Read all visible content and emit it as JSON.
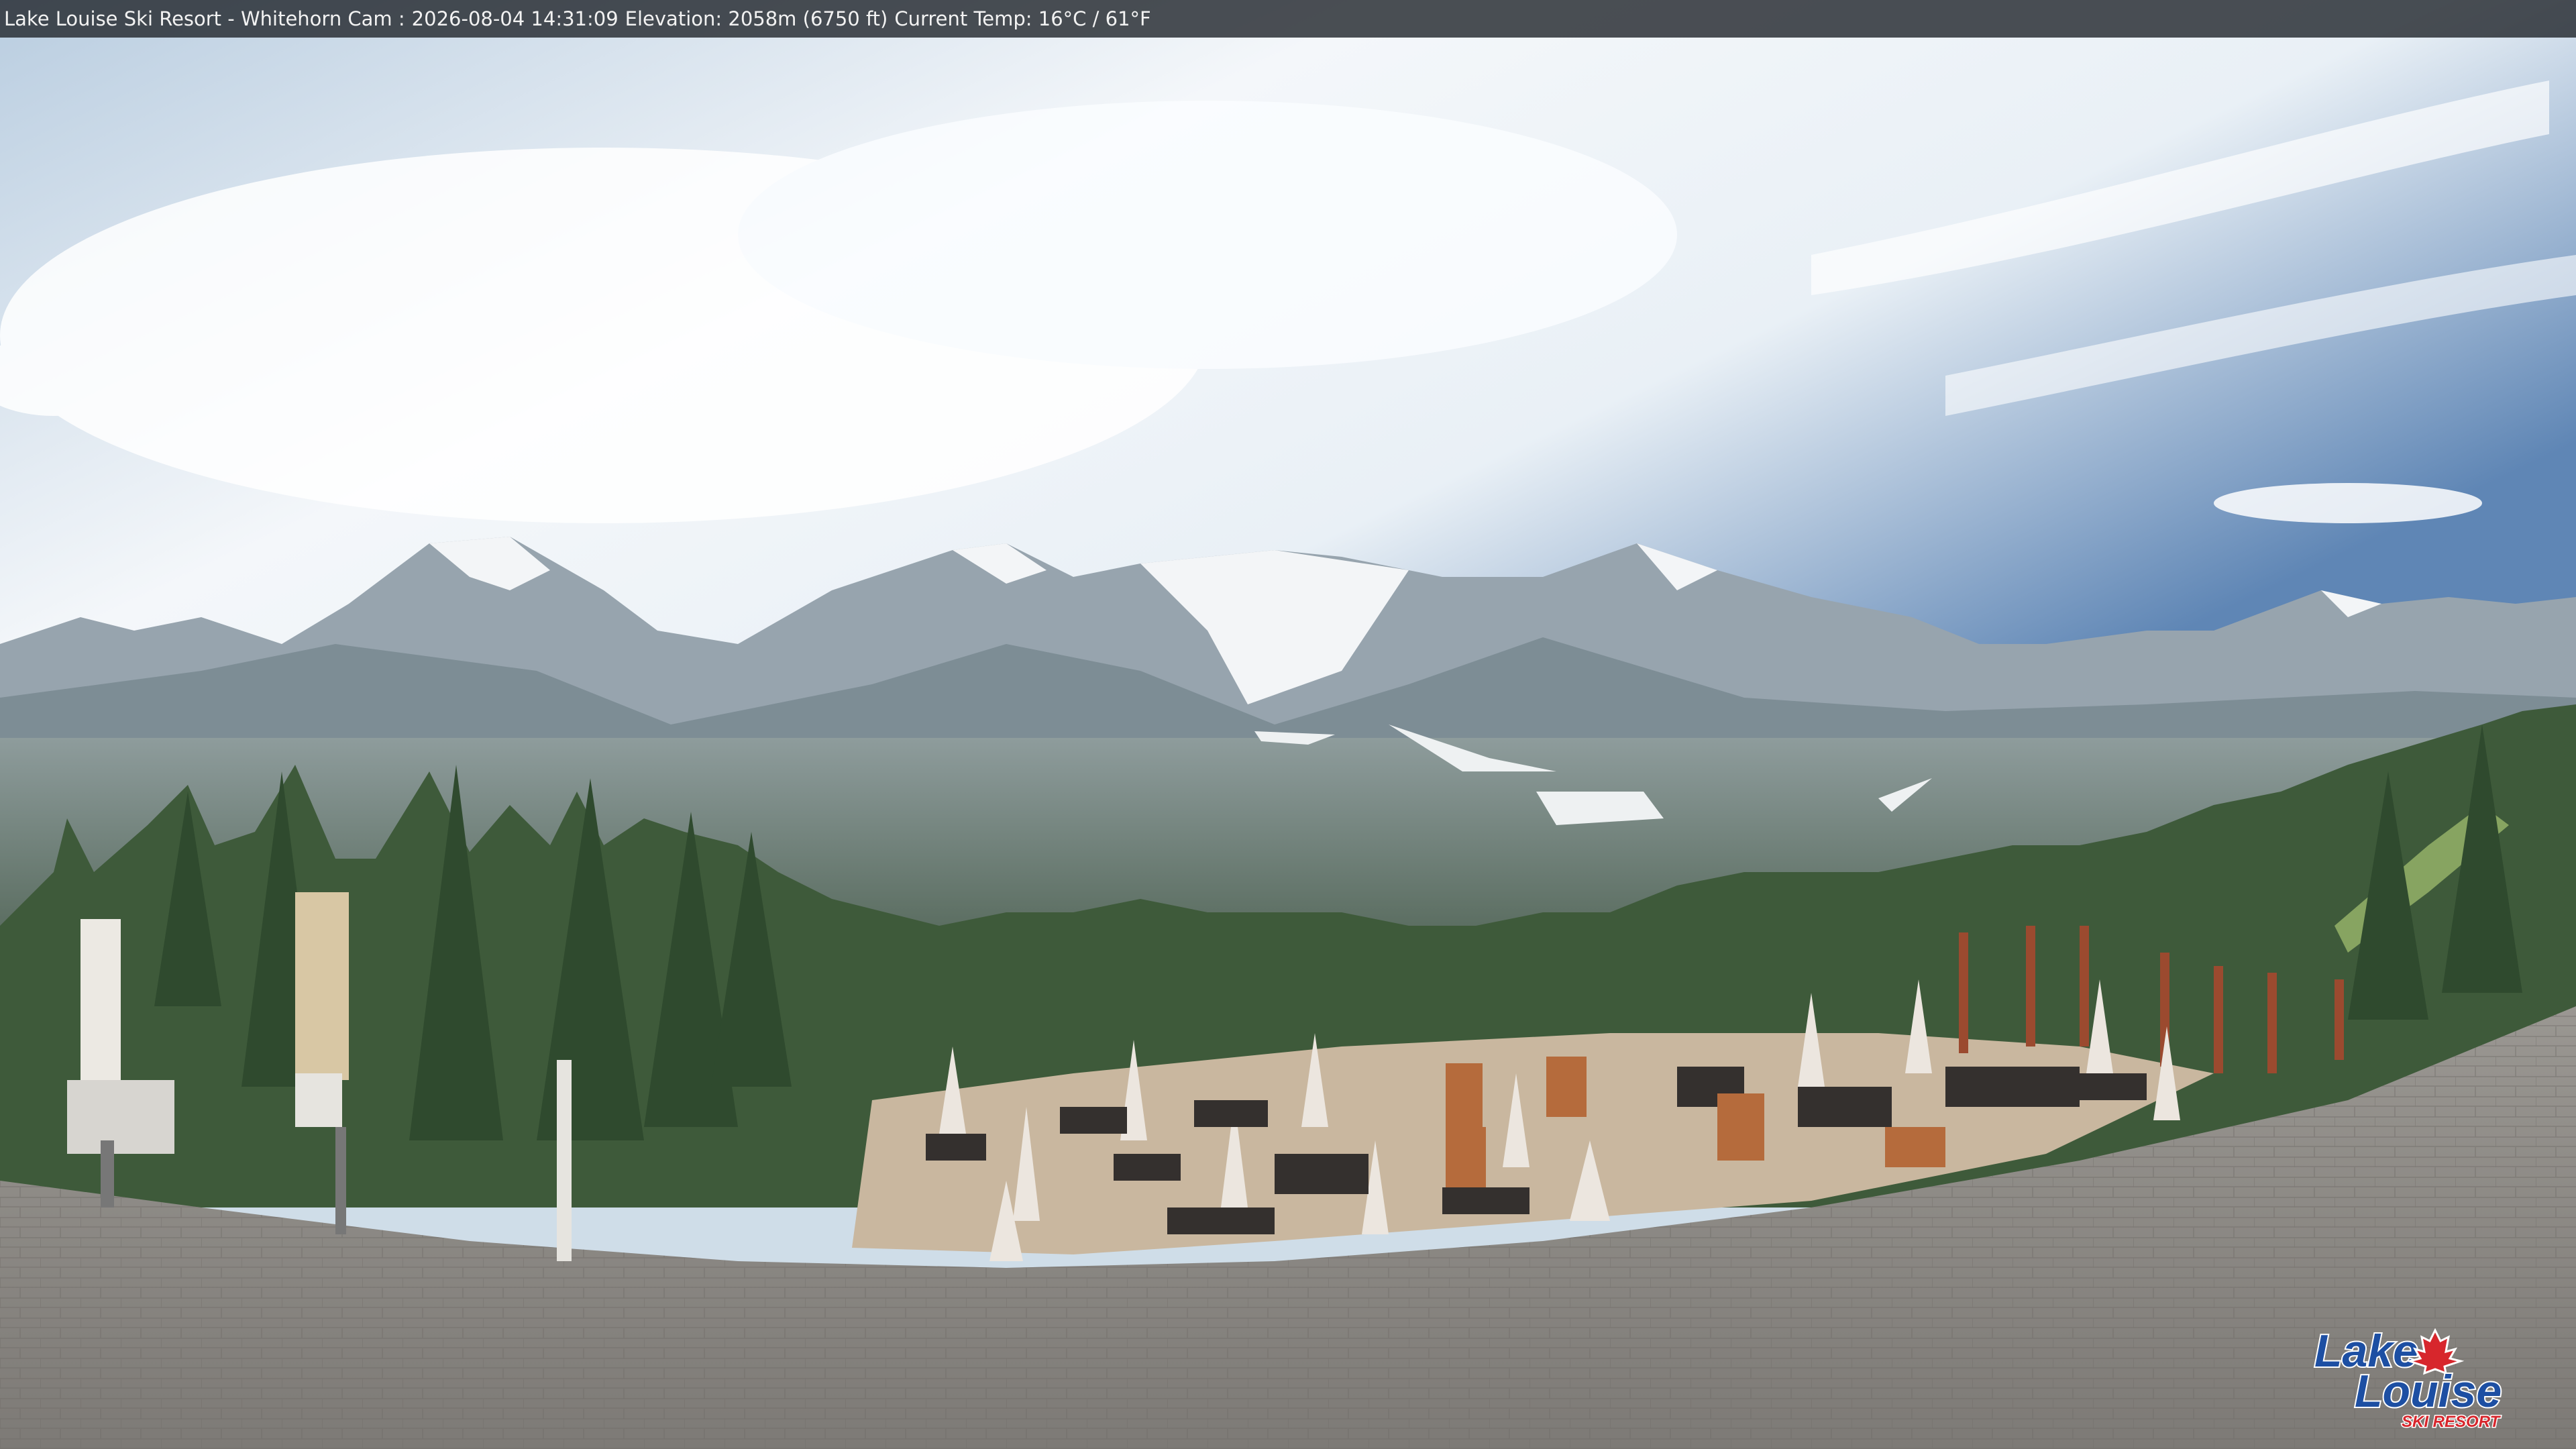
{
  "camera": {
    "title": "Lake Louise Ski Resort - Whitehorn Cam :",
    "timestamp": "2026-08-04 14:31:09",
    "elevation": "Elevation: 2058m (6750 ft)",
    "temperature": "Current Temp: 16°C / 61°F"
  },
  "logo": {
    "line1": "Lake",
    "line2": "Louise",
    "line3": "SKI RESORT",
    "colors": {
      "text": "#1d4fa3",
      "leaf": "#d7262c"
    }
  },
  "scene": {
    "description_icons": [
      "mountain-range",
      "forest",
      "patio-deck",
      "umbrellas",
      "roof"
    ],
    "colors": {
      "sky": "#cfe0ee",
      "mountain": "#8c98a3",
      "snow": "#f3f5f7",
      "forest": "#3e5a3a",
      "roof": "#8f8c88",
      "deck": "#c9b79f"
    }
  }
}
